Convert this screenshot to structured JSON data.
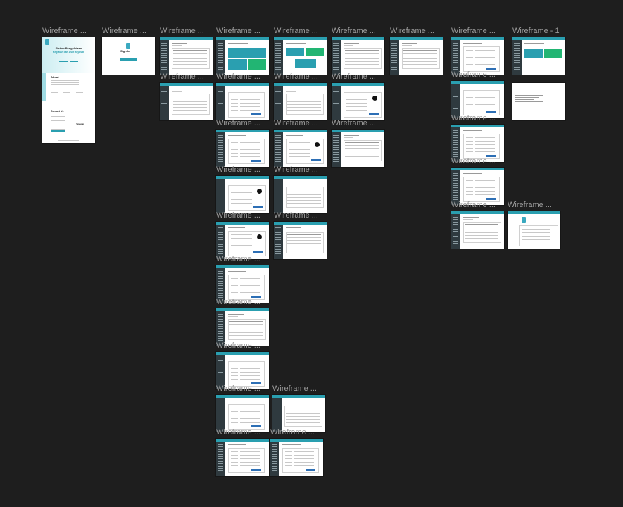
{
  "canvas": {
    "background": "#1e1e1e",
    "accent": "#2a9fb0",
    "green": "#22b573",
    "sidebar": "#2f3a3f"
  },
  "frames": [
    {
      "id": "f1",
      "label": "Wireframe ...",
      "type": "landing",
      "title": "Sistem Pengelolaan",
      "subtitle": "Kegiatan dan Aset Yayasan",
      "section_about": "About",
      "section_contact": "Contact Us",
      "contact_side": "Yayasan"
    },
    {
      "id": "f2",
      "label": "Wireframe ...",
      "type": "login",
      "title": "Sign In"
    },
    {
      "id": "f3",
      "label": "Wireframe ...",
      "type": "table"
    },
    {
      "id": "f4",
      "label": "Wireframe ...",
      "type": "dashboard"
    },
    {
      "id": "f5",
      "label": "Wireframe ...",
      "type": "dashboard2"
    },
    {
      "id": "f6",
      "label": "Wireframe ...",
      "type": "table"
    },
    {
      "id": "f7",
      "label": "Wireframe ...",
      "type": "table"
    },
    {
      "id": "f8",
      "label": "Wireframe ...",
      "type": "form"
    },
    {
      "id": "f9",
      "label": "Wireframe - 1",
      "type": "dashboard3"
    },
    {
      "id": "f10",
      "label": "Wireframe ...",
      "type": "table"
    },
    {
      "id": "f11",
      "label": "Wireframe ...",
      "type": "form"
    },
    {
      "id": "f12",
      "label": "Wireframe ...",
      "type": "table"
    },
    {
      "id": "f13",
      "label": "Wireframe ...",
      "type": "profile"
    },
    {
      "id": "f14",
      "label": "Wireframe ...",
      "type": "form"
    },
    {
      "id": "f15",
      "label": "",
      "type": "text"
    },
    {
      "id": "f16",
      "label": "Wireframe ...",
      "type": "form"
    },
    {
      "id": "f17",
      "label": "Wireframe ...",
      "type": "profile"
    },
    {
      "id": "f18",
      "label": "Wireframe ...",
      "type": "table"
    },
    {
      "id": "f19",
      "label": "Wireframe ...",
      "type": "form"
    },
    {
      "id": "f20",
      "label": "Wireframe ...",
      "type": "profile"
    },
    {
      "id": "f21",
      "label": "Wireframe ...",
      "type": "table"
    },
    {
      "id": "f22",
      "label": "Wireframe ...",
      "type": "form"
    },
    {
      "id": "f23",
      "label": "Wireframe ...",
      "type": "profile2"
    },
    {
      "id": "f24",
      "label": "Wireframe ...",
      "type": "table"
    },
    {
      "id": "f25",
      "label": "Wireframe ...",
      "type": "table"
    },
    {
      "id": "f26",
      "label": "Wireframe ...",
      "type": "dual"
    },
    {
      "id": "f27",
      "label": "Wireframe ...",
      "type": "form"
    },
    {
      "id": "f28",
      "label": "Wireframe ...",
      "type": "table"
    },
    {
      "id": "f29",
      "label": "Wireframe ...",
      "type": "form"
    },
    {
      "id": "f30",
      "label": "Wireframe ...",
      "type": "form"
    },
    {
      "id": "f31",
      "label": "Wireframe ...",
      "type": "table"
    },
    {
      "id": "f32",
      "label": "Wireframe ...",
      "type": "form"
    },
    {
      "id": "f33",
      "label": "Wireframe ...",
      "type": "form"
    },
    {
      "id": "f34",
      "label": "Wireframe ...",
      "type": "form"
    }
  ]
}
